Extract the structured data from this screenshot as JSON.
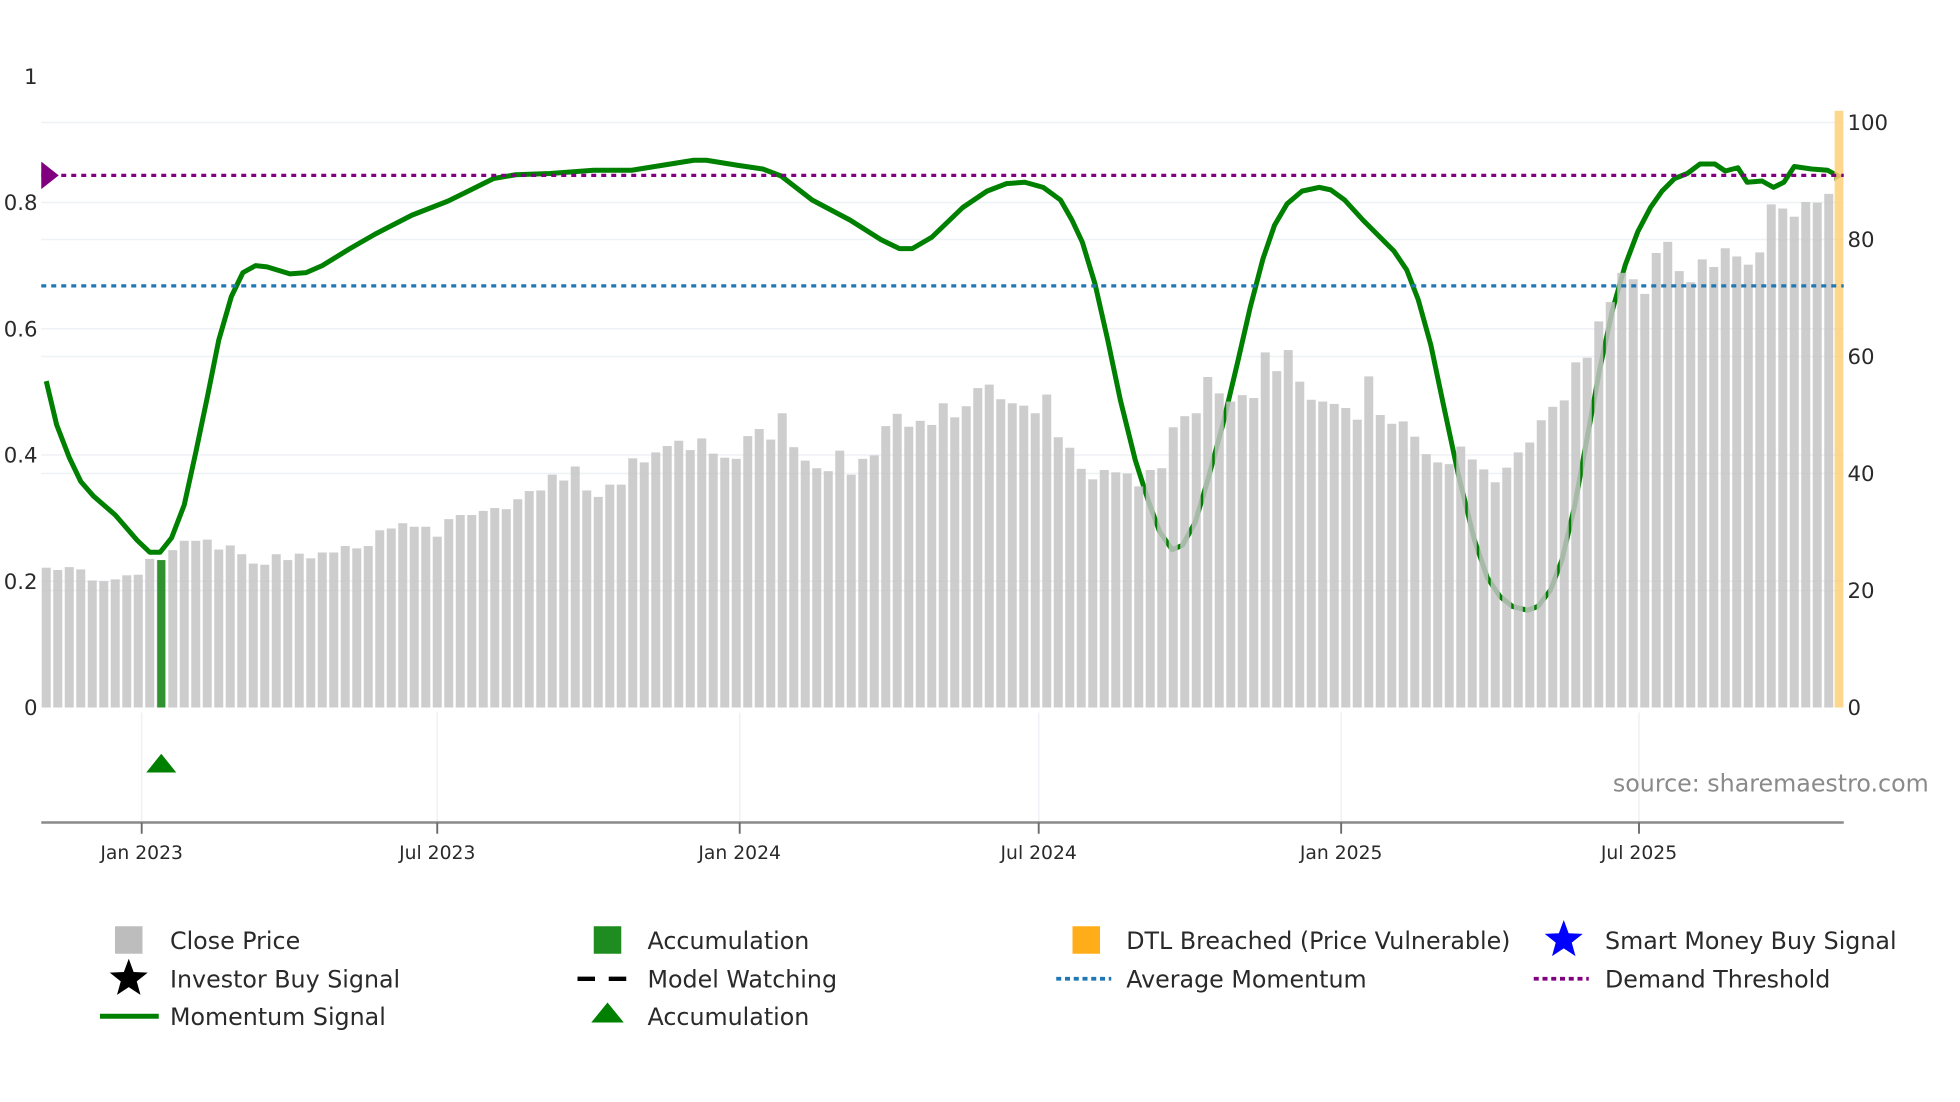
{
  "chart_data": {
    "type": "bar+line",
    "title": "",
    "left_axis": {
      "ticks": [
        "0",
        "0.2",
        "0.4",
        "0.6",
        "0.8",
        "1"
      ],
      "values": [
        0,
        0.2,
        0.4,
        0.6,
        0.8,
        1.0
      ],
      "range": [
        0,
        1
      ]
    },
    "right_axis": {
      "ticks": [
        "0",
        "20",
        "40",
        "60",
        "80",
        "100"
      ],
      "values": [
        0,
        20,
        40,
        60,
        80,
        100
      ],
      "range": [
        0,
        100
      ]
    },
    "x_axis": {
      "unit": "week index",
      "ticks": [
        {
          "label": "Jan 2023",
          "week": 8.3
        },
        {
          "label": "Jul 2023",
          "week": 34.0
        },
        {
          "label": "Jan 2024",
          "week": 60.3
        },
        {
          "label": "Jul 2024",
          "week": 86.3
        },
        {
          "label": "Jan 2025",
          "week": 112.6
        },
        {
          "label": "Jul 2025",
          "week": 138.5
        }
      ]
    },
    "close_price": [
      23.9,
      23.5,
      24.0,
      23.6,
      21.7,
      21.6,
      21.9,
      22.6,
      22.7,
      25.4,
      25.2,
      26.9,
      28.5,
      28.5,
      28.7,
      27.0,
      27.7,
      26.2,
      24.6,
      24.4,
      26.2,
      25.2,
      26.3,
      25.5,
      26.5,
      26.5,
      27.6,
      27.2,
      27.6,
      30.3,
      30.6,
      31.5,
      30.9,
      30.9,
      29.2,
      32.2,
      32.9,
      32.9,
      33.6,
      34.1,
      33.9,
      35.6,
      37.0,
      37.1,
      39.8,
      38.8,
      41.2,
      37.1,
      36.0,
      38.1,
      38.1,
      42.6,
      41.9,
      43.6,
      44.7,
      45.6,
      44.0,
      46.0,
      43.4,
      42.7,
      42.5,
      46.4,
      47.6,
      45.8,
      50.3,
      44.5,
      42.2,
      40.9,
      40.4,
      43.9,
      39.8,
      42.5,
      43.1,
      48.1,
      50.2,
      48.0,
      49.0,
      48.3,
      52.0,
      49.6,
      51.5,
      54.6,
      55.2,
      52.7,
      52.0,
      51.6,
      50.3,
      53.5,
      46.2,
      44.4,
      40.8,
      39.0,
      40.6,
      40.2,
      40.0,
      37.8,
      40.6,
      40.9,
      47.9,
      49.8,
      50.3,
      56.5,
      53.7,
      52.3,
      53.4,
      52.9,
      60.7,
      57.5,
      61.1,
      55.7,
      52.6,
      52.3,
      51.9,
      51.2,
      49.2,
      56.6,
      50.0,
      48.5,
      48.9,
      46.3,
      43.3,
      41.9,
      41.6,
      44.6,
      42.4,
      40.7,
      38.5,
      41.0,
      43.6,
      45.3,
      49.1,
      51.4,
      52.5,
      59.0,
      59.8,
      66.0,
      69.3,
      74.3,
      73.2,
      70.7,
      77.7,
      79.6,
      74.6,
      72.7,
      76.6,
      75.3,
      78.5,
      77.1,
      75.7,
      77.8,
      86.0,
      85.3,
      83.9,
      86.4,
      86.3,
      87.8
    ],
    "accumulation_bars": [
      {
        "week": 10,
        "value": 25.2
      }
    ],
    "accumulation_markers": [
      {
        "week": 10
      }
    ],
    "dtl_breached": [
      {
        "week": 156,
        "value": 102
      }
    ],
    "momentum": [
      [
        0,
        0.517
      ],
      [
        0.9,
        0.448
      ],
      [
        2.0,
        0.396
      ],
      [
        3.0,
        0.358
      ],
      [
        4.1,
        0.335
      ],
      [
        6.0,
        0.305
      ],
      [
        7.9,
        0.265
      ],
      [
        9.0,
        0.246
      ],
      [
        9.9,
        0.246
      ],
      [
        10.9,
        0.269
      ],
      [
        12.0,
        0.321
      ],
      [
        13.0,
        0.404
      ],
      [
        14.0,
        0.491
      ],
      [
        15.0,
        0.582
      ],
      [
        16.1,
        0.651
      ],
      [
        17.1,
        0.689
      ],
      [
        18.2,
        0.7
      ],
      [
        19.2,
        0.698
      ],
      [
        21.2,
        0.687
      ],
      [
        22.6,
        0.689
      ],
      [
        24.0,
        0.7
      ],
      [
        26.4,
        0.727
      ],
      [
        28.6,
        0.75
      ],
      [
        31.8,
        0.78
      ],
      [
        34.9,
        0.802
      ],
      [
        36.7,
        0.818
      ],
      [
        38.9,
        0.838
      ],
      [
        40.8,
        0.844
      ],
      [
        43.8,
        0.846
      ],
      [
        47.6,
        0.851
      ],
      [
        50.9,
        0.851
      ],
      [
        53.6,
        0.859
      ],
      [
        56.3,
        0.867
      ],
      [
        57.4,
        0.867
      ],
      [
        60.1,
        0.859
      ],
      [
        62.3,
        0.853
      ],
      [
        63.9,
        0.842
      ],
      [
        66.6,
        0.804
      ],
      [
        69.9,
        0.772
      ],
      [
        72.6,
        0.741
      ],
      [
        74.2,
        0.727
      ],
      [
        75.3,
        0.727
      ],
      [
        77.0,
        0.745
      ],
      [
        79.7,
        0.792
      ],
      [
        81.8,
        0.818
      ],
      [
        83.5,
        0.83
      ],
      [
        85.1,
        0.832
      ],
      [
        86.7,
        0.824
      ],
      [
        88.2,
        0.804
      ],
      [
        89.2,
        0.772
      ],
      [
        90.1,
        0.737
      ],
      [
        91.2,
        0.671
      ],
      [
        92.3,
        0.582
      ],
      [
        93.4,
        0.487
      ],
      [
        94.7,
        0.392
      ],
      [
        95.8,
        0.329
      ],
      [
        96.8,
        0.279
      ],
      [
        97.9,
        0.25
      ],
      [
        98.8,
        0.257
      ],
      [
        99.9,
        0.293
      ],
      [
        101.0,
        0.36
      ],
      [
        102.3,
        0.448
      ],
      [
        103.6,
        0.547
      ],
      [
        104.7,
        0.634
      ],
      [
        105.8,
        0.711
      ],
      [
        106.8,
        0.764
      ],
      [
        107.9,
        0.798
      ],
      [
        109.2,
        0.818
      ],
      [
        110.7,
        0.824
      ],
      [
        111.7,
        0.82
      ],
      [
        112.9,
        0.804
      ],
      [
        114.5,
        0.772
      ],
      [
        116.1,
        0.743
      ],
      [
        117.2,
        0.723
      ],
      [
        118.3,
        0.693
      ],
      [
        119.3,
        0.646
      ],
      [
        120.4,
        0.574
      ],
      [
        121.5,
        0.479
      ],
      [
        122.8,
        0.368
      ],
      [
        124.2,
        0.265
      ],
      [
        125.3,
        0.206
      ],
      [
        126.4,
        0.176
      ],
      [
        127.5,
        0.16
      ],
      [
        128.8,
        0.154
      ],
      [
        129.7,
        0.16
      ],
      [
        130.8,
        0.186
      ],
      [
        131.8,
        0.234
      ],
      [
        132.9,
        0.319
      ],
      [
        134.0,
        0.428
      ],
      [
        135.1,
        0.537
      ],
      [
        136.2,
        0.63
      ],
      [
        137.3,
        0.701
      ],
      [
        138.4,
        0.754
      ],
      [
        139.5,
        0.792
      ],
      [
        140.5,
        0.818
      ],
      [
        141.6,
        0.838
      ],
      [
        142.7,
        0.846
      ],
      [
        143.8,
        0.861
      ],
      [
        145.1,
        0.861
      ],
      [
        146.0,
        0.85
      ],
      [
        147.1,
        0.855
      ],
      [
        147.9,
        0.832
      ],
      [
        149.2,
        0.834
      ],
      [
        150.2,
        0.824
      ],
      [
        151.1,
        0.832
      ],
      [
        152.0,
        0.857
      ],
      [
        153.5,
        0.853
      ],
      [
        154.9,
        0.851
      ],
      [
        155.8,
        0.842
      ]
    ],
    "demand_threshold": 0.843,
    "average_momentum": 0.668,
    "grid": true,
    "legend_position": "bottom",
    "legend": [
      {
        "label": "Close Price",
        "color": "#bdbdbd",
        "symbol": "square"
      },
      {
        "label": "Accumulation",
        "color": "#1e8c1e",
        "symbol": "square"
      },
      {
        "label": "DTL Breached (Price Vulnerable)",
        "color": "#ffae1a",
        "symbol": "square"
      },
      {
        "label": "Smart Money Buy Signal",
        "color": "#0000ff",
        "symbol": "star"
      },
      {
        "label": "Investor Buy Signal",
        "color": "#000000",
        "symbol": "star"
      },
      {
        "label": "Model Watching",
        "color": "#000000",
        "symbol": "dash"
      },
      {
        "label": "Average Momentum",
        "color": "#1f77b4",
        "symbol": "dot"
      },
      {
        "label": "Demand Threshold",
        "color": "#800080",
        "symbol": "dot"
      },
      {
        "label": "Momentum Signal",
        "color": "#008000",
        "symbol": "line"
      },
      {
        "label": "Accumulation",
        "color": "#008000",
        "symbol": "triangle"
      }
    ],
    "source": "source: sharemaestro.com"
  }
}
